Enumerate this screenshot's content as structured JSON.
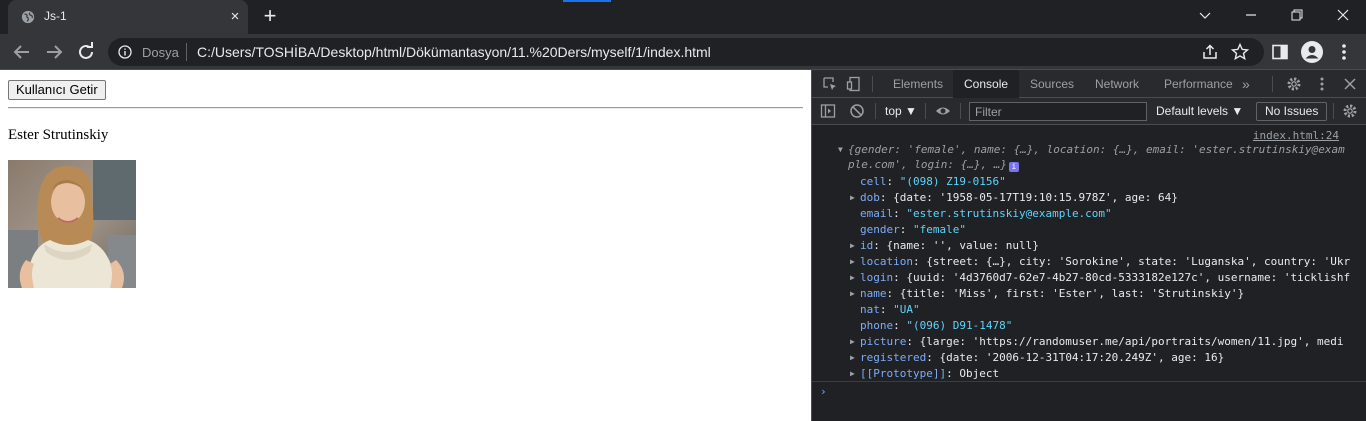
{
  "browser": {
    "tab_title": "Js-1",
    "tab_close": "×",
    "new_tab": "+",
    "scheme_label": "Dosya",
    "url": "C:/Users/TOSHİBA/Desktop/html/Dökümantasyon/11.%20Ders/myself/1/index.html"
  },
  "page": {
    "button_label": "Kullanıcı Getir",
    "user_name": "Ester Strutinskiy"
  },
  "devtools": {
    "tabs": [
      "Elements",
      "Console",
      "Sources",
      "Network",
      "Performance"
    ],
    "active_tab": "Console",
    "more_tabs": "»",
    "context": "top ▼",
    "filter_placeholder": "Filter",
    "levels": "Default levels ▼",
    "issues": "No Issues",
    "source_link": "index.html:24",
    "object_summary_1": "{gender: 'female', name: {…}, location: {…}, email: 'ester.strutinskiy@exam",
    "object_summary_2": "ple.com', login: {…}, …}",
    "info_badge": "i",
    "props": [
      {
        "key": "cell",
        "sep": ": ",
        "value": "\"(098) Z19-0156\"",
        "expandable": false
      },
      {
        "key": "dob",
        "sep": ": ",
        "value": "{date: '1958-05-17T19:10:15.978Z', age: 64}",
        "expandable": true
      },
      {
        "key": "email",
        "sep": ": ",
        "value": "\"ester.strutinskiy@example.com\"",
        "expandable": false
      },
      {
        "key": "gender",
        "sep": ": ",
        "value": "\"female\"",
        "expandable": false
      },
      {
        "key": "id",
        "sep": ": ",
        "value": "{name: '', value: null}",
        "expandable": true
      },
      {
        "key": "location",
        "sep": ": ",
        "value": "{street: {…}, city: 'Sorokine', state: 'Luganska', country: 'Ukr",
        "expandable": true
      },
      {
        "key": "login",
        "sep": ": ",
        "value": "{uuid: '4d3760d7-62e7-4b27-80cd-5333182e127c', username: 'ticklishf",
        "expandable": true
      },
      {
        "key": "name",
        "sep": ": ",
        "value": "{title: 'Miss', first: 'Ester', last: 'Strutinskiy'}",
        "expandable": true
      },
      {
        "key": "nat",
        "sep": ": ",
        "value": "\"UA\"",
        "expandable": false
      },
      {
        "key": "phone",
        "sep": ": ",
        "value": "\"(096) D91-1478\"",
        "expandable": false
      },
      {
        "key": "picture",
        "sep": ": ",
        "value": "{large: 'https://randomuser.me/api/portraits/women/11.jpg', medi",
        "expandable": true
      },
      {
        "key": "registered",
        "sep": ": ",
        "value": "{date: '2006-12-31T04:17:20.249Z', age: 16}",
        "expandable": true
      },
      {
        "key": "[[Prototype]]",
        "sep": ": ",
        "value": "Object",
        "expandable": true
      }
    ],
    "prompt": "›"
  },
  "colors": {
    "key": "#7cacf8",
    "string": "#5cd5fb",
    "number": "#9980ff",
    "chrome_dark": "#202124"
  },
  "icons": [
    "globe-icon",
    "close-icon",
    "plus-icon",
    "back-icon",
    "forward-icon",
    "reload-icon",
    "info-icon",
    "share-icon",
    "star-icon",
    "sidebar-icon",
    "profile-icon",
    "menu-icon",
    "inspect-icon",
    "device-icon",
    "gear-icon",
    "dock-menu-icon",
    "close-devtools-icon",
    "sidebar-toggle-icon",
    "clear-console-icon",
    "eye-icon",
    "chevron-down-icon"
  ]
}
